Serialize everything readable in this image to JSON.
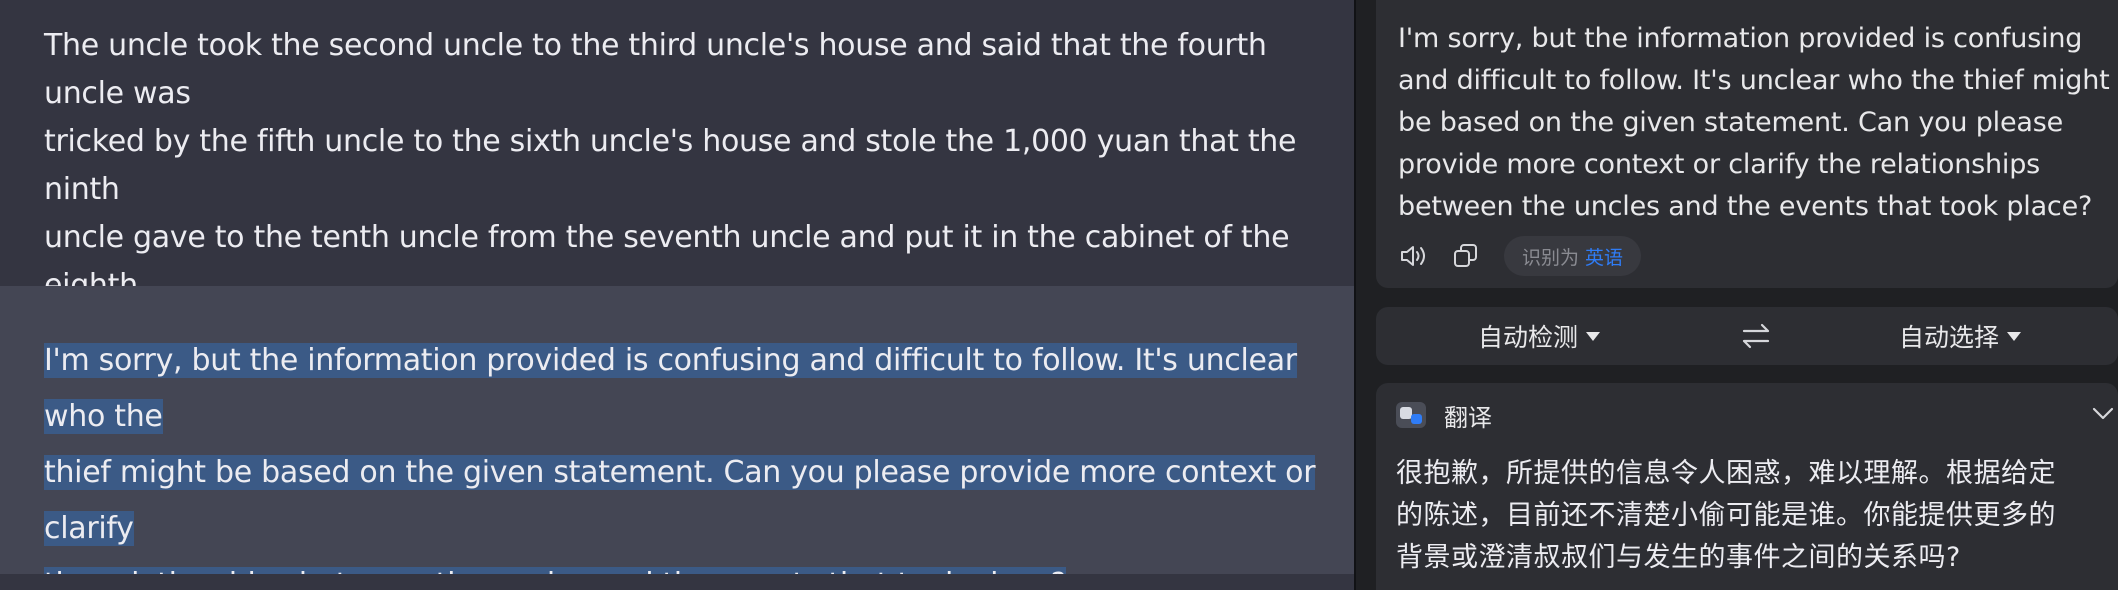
{
  "chat": {
    "user_message": "The uncle took the second uncle to the third uncle's house and said that the fourth uncle was\ntricked by the fifth uncle to the sixth uncle's house and stole the 1,000 yuan that the ninth\nuncle gave to the tenth uncle from the seventh uncle and put it in the cabinet of the eighth\nuncle's house. Please reason step by step, who is the thief?",
    "assistant_line1": "I'm sorry, but the information provided is confusing and difficult to follow. It's unclear who the",
    "assistant_line2": "thief might be based on the given statement. Can you please provide more context or clarify",
    "assistant_line3": "the relationships between the uncles and the events that took place?"
  },
  "translator": {
    "source_text": "I'm sorry, but the information provided is confusing\nand difficult to follow. It's unclear who the thief might\nbe based on the given statement. Can you please\nprovide more context or clarify the relationships\nbetween the uncles and the events that took place?",
    "detected_prefix": "识别为",
    "detected_lang": "英语",
    "source_lang": "自动检测",
    "target_lang": "自动选择",
    "result_title": "翻译",
    "result_text": "很抱歉，所提供的信息令人困惑，难以理解。根据给定\n的陈述，目前还不清楚小偷可能是谁。你能提供更多的\n背景或澄清叔叔们与发生的事件之间的关系吗?",
    "icons": [
      "speaker-icon",
      "copy-icon",
      "swap-icon",
      "chevron-down-icon"
    ]
  },
  "colors": {
    "selection": "#3b5a86",
    "accent": "#2f7cf6"
  }
}
